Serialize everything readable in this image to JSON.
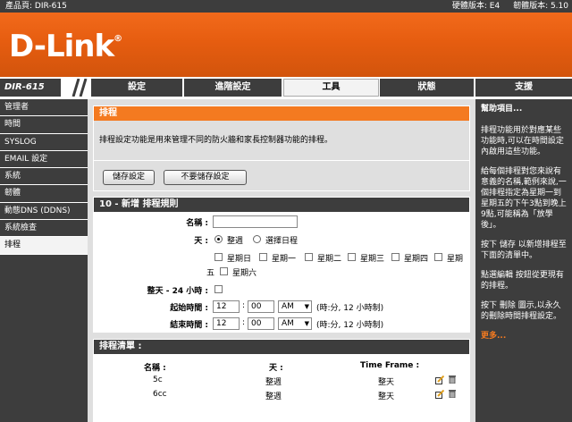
{
  "topbar": {
    "product": "產品頁: DIR-615",
    "hw": "硬體版本: E4",
    "fw": "韌體版本: 5.10"
  },
  "brand": {
    "logo": "D-Link",
    "logo_mark": "®",
    "model": "DIR-615"
  },
  "tabs": [
    {
      "label": "設定"
    },
    {
      "label": "進階設定"
    },
    {
      "label": "工具"
    },
    {
      "label": "狀態"
    },
    {
      "label": "支援"
    }
  ],
  "sidebar": {
    "items": [
      {
        "label": "管理者"
      },
      {
        "label": "時間"
      },
      {
        "label": "SYSLOG"
      },
      {
        "label": "EMAIL 設定"
      },
      {
        "label": "系統"
      },
      {
        "label": "韌體"
      },
      {
        "label": "動態DNS (DDNS)"
      },
      {
        "label": "系統檢查"
      },
      {
        "label": "排程"
      }
    ]
  },
  "schedule_box": {
    "title": "排程",
    "description": "排程設定功能是用來管理不同的防火牆和家長控制器功能的排程。",
    "save_label": "儲存設定",
    "dont_save_label": "不要儲存設定"
  },
  "rule_box": {
    "title": "10 - 新增 排程規則",
    "name_label": "名稱 :",
    "name_value": "",
    "day_label": "天 :",
    "opt_week": "整週",
    "opt_select": "選擇日程",
    "days": [
      "星期日",
      "星期一",
      "星期二",
      "星期三",
      "星期四",
      "星期",
      "五",
      "星期六"
    ],
    "allday_label": "整天 - 24 小時 :",
    "start_label": "起始時間 :",
    "end_label": "結束時間 :",
    "start_h": "12",
    "start_m": "00",
    "start_ampm": "AM",
    "end_h": "12",
    "end_m": "00",
    "end_ampm": "AM",
    "colon": ":",
    "hint": "(時:分, 12 小時制)"
  },
  "list_box": {
    "title": "排程清單 :",
    "headers": {
      "name": "名稱 :",
      "day": "天 :",
      "frame": "Time Frame :"
    },
    "rows": [
      {
        "name": "5c",
        "day": "整週",
        "frame": "整天"
      },
      {
        "name": "6cc",
        "day": "整週",
        "frame": "整天"
      }
    ]
  },
  "help": {
    "title": "幫助項目...",
    "p1": "排程功能用於對應某些功能時,可以在時間設定內啟用這些功能。",
    "p2": "給每個排程對您來說有意義的名稱,範例來說,一個排程指定為星期一到星期五的下午3點到晚上9點,可能稱為「放學後」。",
    "p3": "按下 儲存 以新增排程至下面的清單中。",
    "p4": "點選編輯 按鈕從更現有的排程。",
    "p5": "按下 刪除 圖示,以永久的刪除時間排程設定。",
    "more": "更多..."
  },
  "colors": {
    "accent": "#f47a20",
    "dark": "#3d3d3d",
    "panel": "#dfdfdf"
  }
}
